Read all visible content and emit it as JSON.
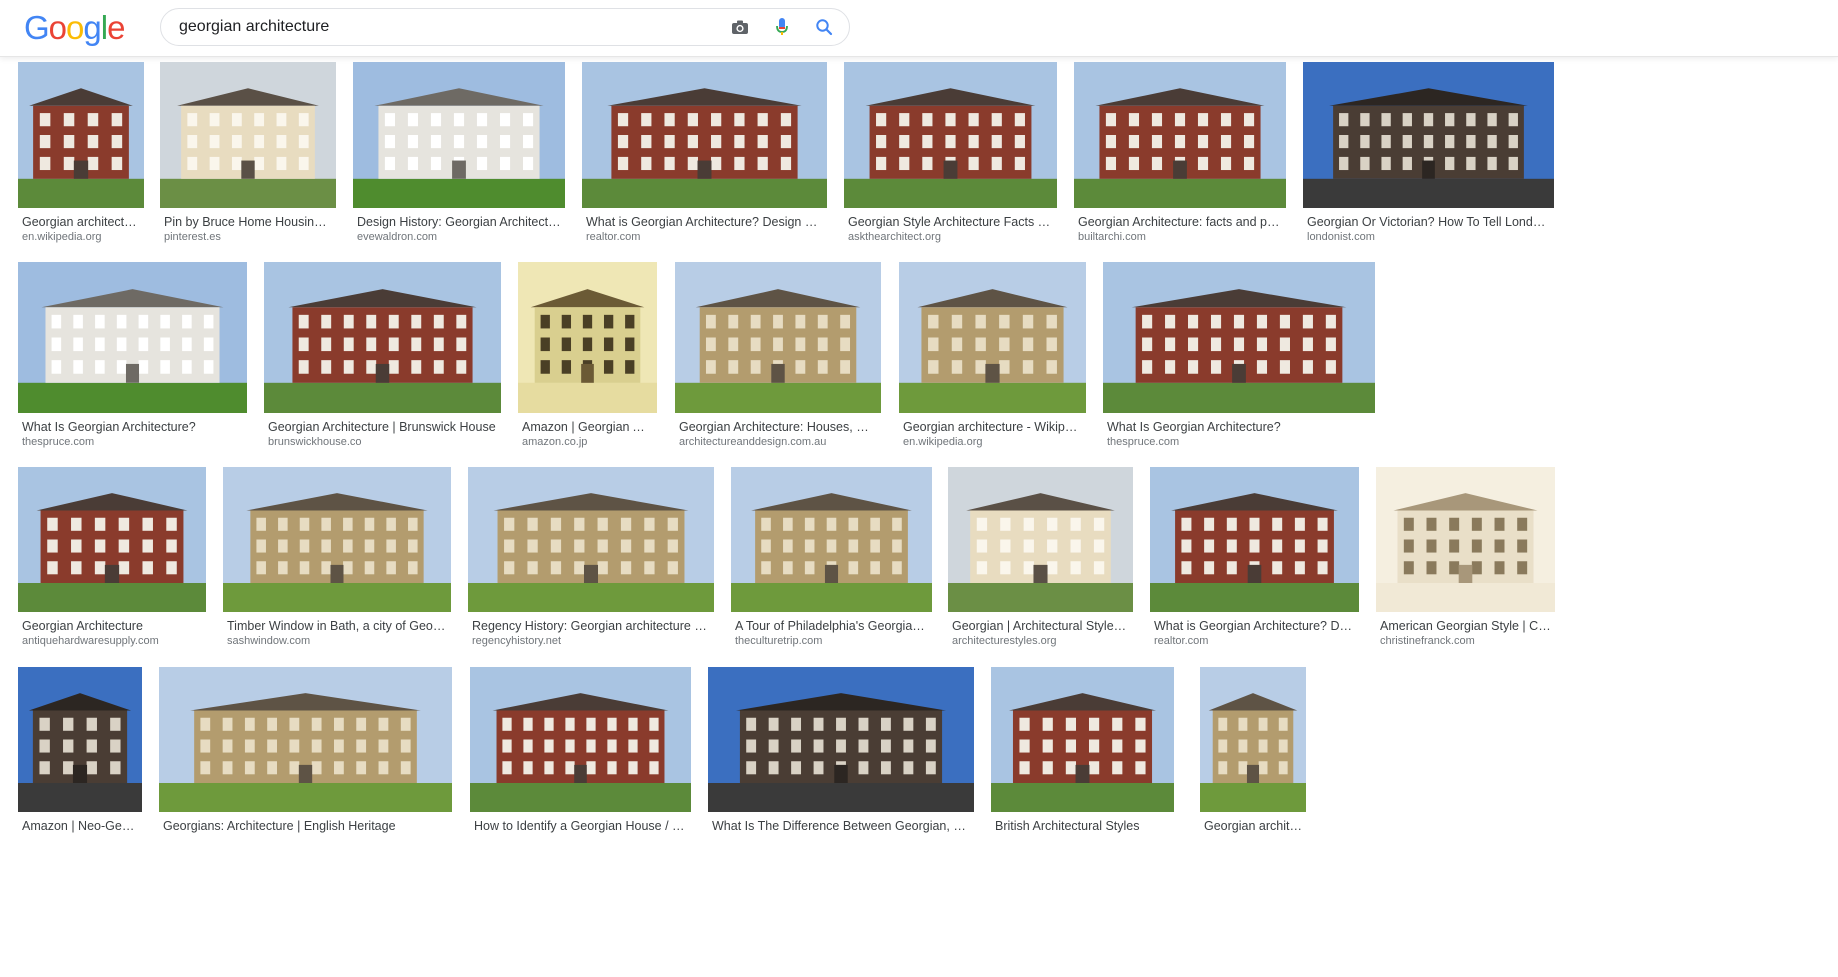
{
  "logo": {
    "letters": [
      "G",
      "o",
      "o",
      "g",
      "l",
      "e"
    ],
    "colors": [
      "#4285F4",
      "#EA4335",
      "#FBBC05",
      "#4285F4",
      "#34A853",
      "#EA4335"
    ]
  },
  "search": {
    "value": "georgian architecture",
    "placeholder": ""
  },
  "icons": {
    "camera": "camera-icon",
    "mic": "microphone-icon",
    "search": "search-icon"
  },
  "results": [
    {
      "title": "Georgian architecture - …",
      "source": "en.wikipedia.org",
      "palette": "brick"
    },
    {
      "title": "Pin by Bruce Home Housing Labor…",
      "source": "pinterest.es",
      "palette": "cream"
    },
    {
      "title": "Design History: Georgian Architecture - ev…",
      "source": "evewaldron.com",
      "palette": "white"
    },
    {
      "title": "What is Georgian Architecture? Design Character…",
      "source": "realtor.com",
      "palette": "brick"
    },
    {
      "title": "Georgian Style Architecture Facts and Hist…",
      "source": "askthearchitect.org",
      "palette": "brick"
    },
    {
      "title": "Georgian Architecture: facts and philosop…",
      "source": "builtarchi.com",
      "palette": "brick"
    },
    {
      "title": "Georgian Or Victorian? How To Tell London's Archi…",
      "source": "londonist.com",
      "palette": "dark"
    },
    {
      "title": "What Is Georgian Architecture?",
      "source": "thespruce.com",
      "palette": "white"
    },
    {
      "title": "Georgian Architecture | Brunswick House",
      "source": "brunswickhouse.co",
      "palette": "brick"
    },
    {
      "title": "Amazon | Georgian Archit…",
      "source": "amazon.co.jp",
      "palette": "book"
    },
    {
      "title": "Georgian Architecture: Houses, Buildings…",
      "source": "architectureanddesign.com.au",
      "palette": "stone"
    },
    {
      "title": "Georgian architecture - Wikipedia",
      "source": "en.wikipedia.org",
      "palette": "stone"
    },
    {
      "title": "What Is Georgian Architecture?",
      "source": "thespruce.com",
      "palette": "brick"
    },
    {
      "title": "Georgian Architecture",
      "source": "antiquehardwaresupply.com",
      "palette": "brick"
    },
    {
      "title": "Timber Window in Bath, a city of Georgian Ar…",
      "source": "sashwindow.com",
      "palette": "stone"
    },
    {
      "title": "Regency History: Georgian architecture - a Regen…",
      "source": "regencyhistory.net",
      "palette": "stone"
    },
    {
      "title": "A Tour of Philadelphia's Georgian Archit…",
      "source": "theculturetrip.com",
      "palette": "stone"
    },
    {
      "title": "Georgian | Architectural Styles of A…",
      "source": "architecturestyles.org",
      "palette": "cream"
    },
    {
      "title": "What is Georgian Architecture? Design C…",
      "source": "realtor.com",
      "palette": "brick"
    },
    {
      "title": "American Georgian Style | Christin…",
      "source": "christinefranck.com",
      "palette": "sketch"
    },
    {
      "title": "Amazon | Neo-Georgia…",
      "source": "",
      "palette": "dark"
    },
    {
      "title": "Georgians: Architecture | English Heritage",
      "source": "",
      "palette": "stone"
    },
    {
      "title": "How to Identify a Georgian House / Georgia…",
      "source": "",
      "palette": "brick"
    },
    {
      "title": "What Is The Difference Between Georgian, Victorian a…",
      "source": "",
      "palette": "dark"
    },
    {
      "title": "British Architectural Styles",
      "source": "",
      "palette": "brick"
    },
    {
      "title": "Georgian architecture. …",
      "source": "",
      "palette": "stone"
    }
  ]
}
